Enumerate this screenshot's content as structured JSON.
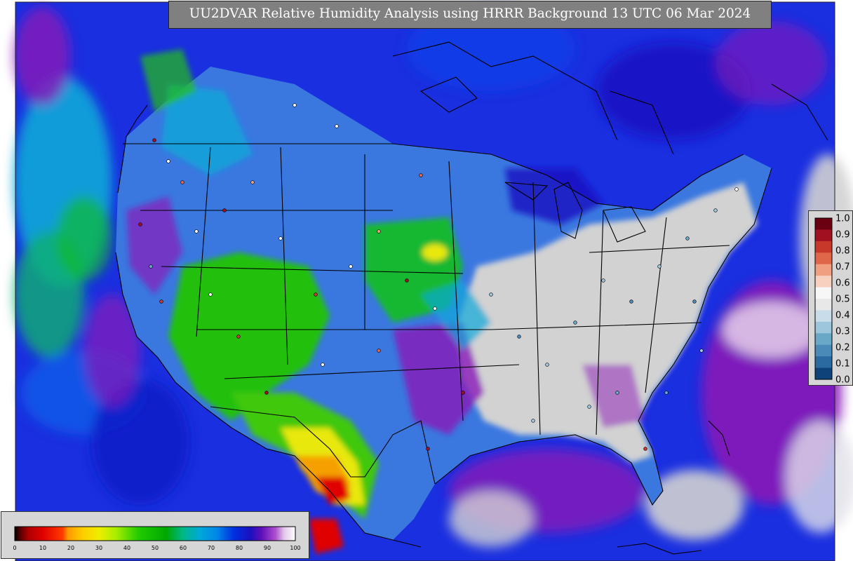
{
  "title": "UU2DVAR Relative Humidity Analysis using HRRR Background 13 UTC 06 Mar 2024",
  "colors": {
    "ocean_deep": "#1a2fe0",
    "ocean_cyan": "#0aa8d8",
    "land_saturated": "#d2d2d2",
    "purple": "#8a18b8",
    "green": "#12c012",
    "yellow": "#e8e80a",
    "orange": "#f5a000",
    "red": "#e00000",
    "border": "#000000"
  },
  "rh_colorbar": {
    "ticks": [
      "0",
      "10",
      "20",
      "30",
      "40",
      "50",
      "60",
      "70",
      "80",
      "90",
      "100"
    ],
    "stops": [
      {
        "v": 0,
        "c": "#000000"
      },
      {
        "v": 2,
        "c": "#5a0000"
      },
      {
        "v": 5,
        "c": "#b00000"
      },
      {
        "v": 10,
        "c": "#e00000"
      },
      {
        "v": 17,
        "c": "#ff3a00"
      },
      {
        "v": 19,
        "c": "#ff9a00"
      },
      {
        "v": 24,
        "c": "#ffcc00"
      },
      {
        "v": 30,
        "c": "#eeee00"
      },
      {
        "v": 36,
        "c": "#aaee00"
      },
      {
        "v": 44,
        "c": "#22cc00"
      },
      {
        "v": 54,
        "c": "#00a800"
      },
      {
        "v": 60,
        "c": "#00b888"
      },
      {
        "v": 66,
        "c": "#00a8d8"
      },
      {
        "v": 72,
        "c": "#0088e8"
      },
      {
        "v": 78,
        "c": "#0030e0"
      },
      {
        "v": 84,
        "c": "#1a10c0"
      },
      {
        "v": 88,
        "c": "#6010b8"
      },
      {
        "v": 93,
        "c": "#b050d0"
      },
      {
        "v": 96,
        "c": "#e0c8e8"
      },
      {
        "v": 100,
        "c": "#ffffff"
      }
    ]
  },
  "qc_colorbar": {
    "ticks": [
      "1.0",
      "0.9",
      "0.8",
      "0.7",
      "0.6",
      "0.5",
      "0.4",
      "0.3",
      "0.2",
      "0.1",
      "0.0"
    ],
    "colors": [
      "#6b0010",
      "#a01020",
      "#c8382a",
      "#e0664a",
      "#f0a080",
      "#f8d0c0",
      "#f7f7f7",
      "#e8e8e8",
      "#c8dcea",
      "#9cc6dc",
      "#6aa8c8",
      "#4a8ab8",
      "#2a6aa0",
      "#10427a"
    ]
  }
}
